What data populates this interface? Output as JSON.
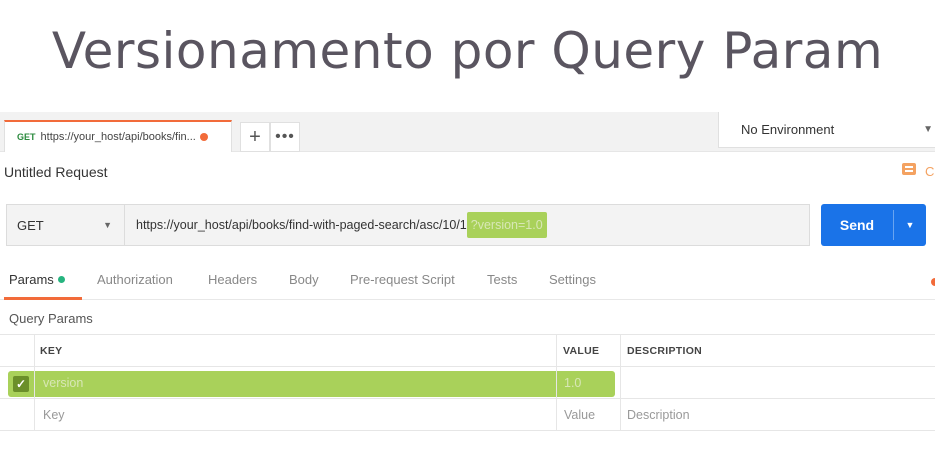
{
  "slide": {
    "title": "Versionamento por Query Param"
  },
  "tabs": {
    "active_tab": {
      "method": "GET",
      "url": "https://your_host/api/books/fin..."
    },
    "add_label": "+",
    "more_label": "•••"
  },
  "environment": {
    "selected": "No Environment"
  },
  "request": {
    "name": "Untitled Request",
    "comment_letter": "C"
  },
  "url_bar": {
    "method": "GET",
    "url_base": "https://your_host/api/books/find-with-paged-search/asc/10/1",
    "url_query": "?version=1.0",
    "send_label": "Send"
  },
  "subtabs": [
    "Params",
    "Authorization",
    "Headers",
    "Body",
    "Pre-request Script",
    "Tests",
    "Settings"
  ],
  "query_params": {
    "title": "Query Params",
    "headers": {
      "key": "KEY",
      "value": "VALUE",
      "description": "DESCRIPTION"
    },
    "rows": [
      {
        "checked": true,
        "key": "version",
        "value": "1.0",
        "description": ""
      }
    ],
    "placeholder": {
      "key": "Key",
      "value": "Value",
      "description": "Description"
    }
  },
  "colors": {
    "accent_orange": "#f26b3a",
    "send_blue": "#1a73e8",
    "highlight_green": "#a9d15a",
    "params_dot": "#26b47f"
  }
}
